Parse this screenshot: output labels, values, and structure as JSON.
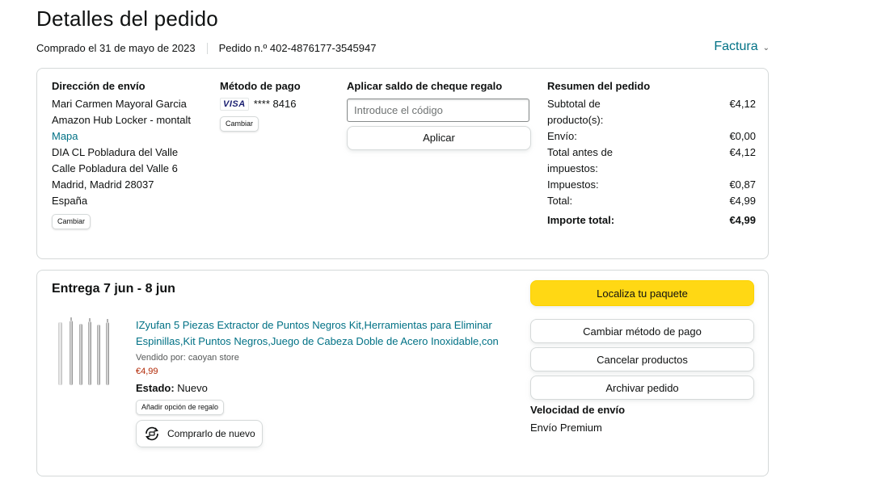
{
  "page": {
    "title": "Detalles del pedido",
    "purchase_date": "Comprado el 31 de mayo de 2023",
    "order_number": "Pedido n.º 402-4876177-3545947",
    "invoice_label": "Factura"
  },
  "shipping": {
    "heading": "Dirección de envío",
    "name": "Mari Carmen Mayoral Garcia",
    "locker": "Amazon Hub Locker - montalt",
    "map_link": "Mapa",
    "line1": "DIA CL Pobladura del Valle",
    "line2": "Calle Pobladura del Valle 6",
    "line3": "Madrid, Madrid 28037",
    "country": "España",
    "change_label": "Cambiar"
  },
  "payment": {
    "heading": "Método de pago",
    "card_brand": "VISA",
    "card_digits": "**** 8416",
    "change_label": "Cambiar"
  },
  "gift": {
    "heading": "Aplicar saldo de cheque regalo",
    "placeholder": "Introduce el código",
    "apply_label": "Aplicar"
  },
  "summary": {
    "heading": "Resumen del pedido",
    "rows": [
      {
        "label": "Subtotal de producto(s):",
        "value": "€4,12"
      },
      {
        "label": "Envío:",
        "value": "€0,00"
      },
      {
        "label": "Total antes de impuestos:",
        "value": "€4,12"
      },
      {
        "label": "Impuestos:",
        "value": "€0,87"
      },
      {
        "label": "Total:",
        "value": "€4,99"
      }
    ],
    "grand_total_label": "Importe total:",
    "grand_total_value": "€4,99"
  },
  "delivery": {
    "title": "Entrega 7 jun - 8 jun",
    "product_title": "IZyufan 5 Piezas Extractor de Puntos Negros Kit,Herramientas para Eliminar Espinillas,Kit Puntos Negros,Juego de Cabeza Doble de Acero Inoxidable,con",
    "seller": "Vendido por: caoyan store",
    "price": "€4,99",
    "state_label": "Estado:",
    "state_value": "Nuevo",
    "gift_option_label": "Añadir opción de regalo",
    "buy_again_label": "Comprarlo de nuevo"
  },
  "actions": {
    "track": "Localiza tu paquete",
    "change_payment": "Cambiar método de pago",
    "cancel": "Cancelar productos",
    "archive": "Archivar pedido",
    "speed_heading": "Velocidad de envío",
    "speed_value": "Envío Premium"
  },
  "colors": {
    "link": "#007185",
    "primary_button": "#ffd814",
    "price": "#b12704",
    "border": "#d5d9d9"
  },
  "icons": {
    "invoice": "chevron-down-icon",
    "buy_again": "refresh-cart-icon",
    "card": "visa-logo"
  }
}
